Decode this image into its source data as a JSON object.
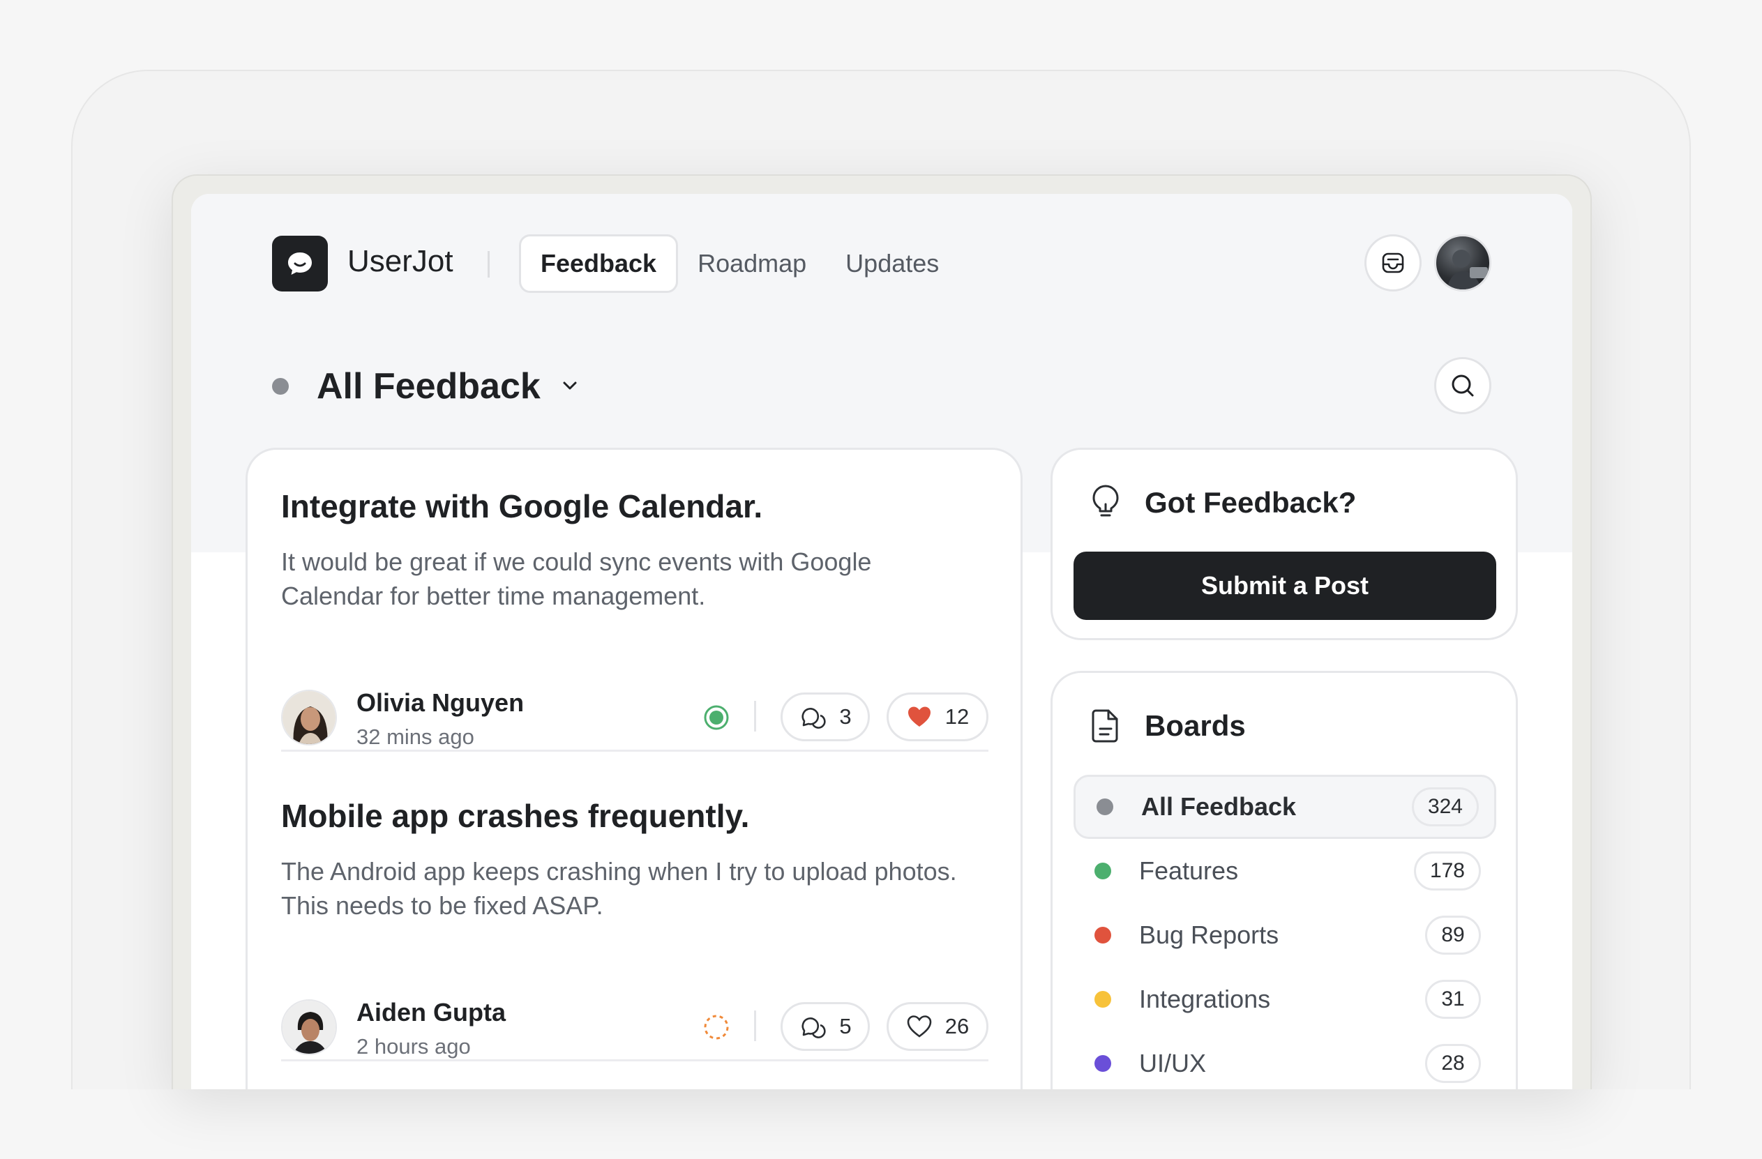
{
  "brand": {
    "name": "UserJot"
  },
  "nav": {
    "tabs": [
      {
        "label": "Feedback",
        "active": true
      },
      {
        "label": "Roadmap",
        "active": false
      },
      {
        "label": "Updates",
        "active": false
      }
    ]
  },
  "board": {
    "title": "All Feedback"
  },
  "posts": [
    {
      "title": "Integrate with Google Calendar.",
      "description": "It would be great if we could sync events with Google Calendar for better time management.",
      "author": "Olivia Nguyen",
      "time": "32 mins ago",
      "status": "completed",
      "comments": "3",
      "likes": "12",
      "liked": true
    },
    {
      "title": "Mobile app crashes frequently.",
      "description": "The Android app keeps crashing when I try to upload photos. This needs to be fixed ASAP.",
      "author": "Aiden Gupta",
      "time": "2 hours ago",
      "status": "pending",
      "comments": "5",
      "likes": "26",
      "liked": false
    }
  ],
  "feedback_card": {
    "title": "Got Feedback?",
    "button": "Submit a Post"
  },
  "boards_card": {
    "title": "Boards",
    "items": [
      {
        "label": "All Feedback",
        "count": "324",
        "color": "#8a8d93",
        "selected": true
      },
      {
        "label": "Features",
        "count": "178",
        "color": "#4caf6e",
        "selected": false
      },
      {
        "label": "Bug Reports",
        "count": "89",
        "color": "#e0533d",
        "selected": false
      },
      {
        "label": "Integrations",
        "count": "31",
        "color": "#f7c23a",
        "selected": false
      },
      {
        "label": "UI/UX",
        "count": "28",
        "color": "#6a4fd8",
        "selected": false
      }
    ]
  },
  "colors": {
    "accent_dark": "#1f2124",
    "like_red": "#e0533d",
    "status_green": "#4caf6e",
    "status_orange": "#f08a3a"
  }
}
